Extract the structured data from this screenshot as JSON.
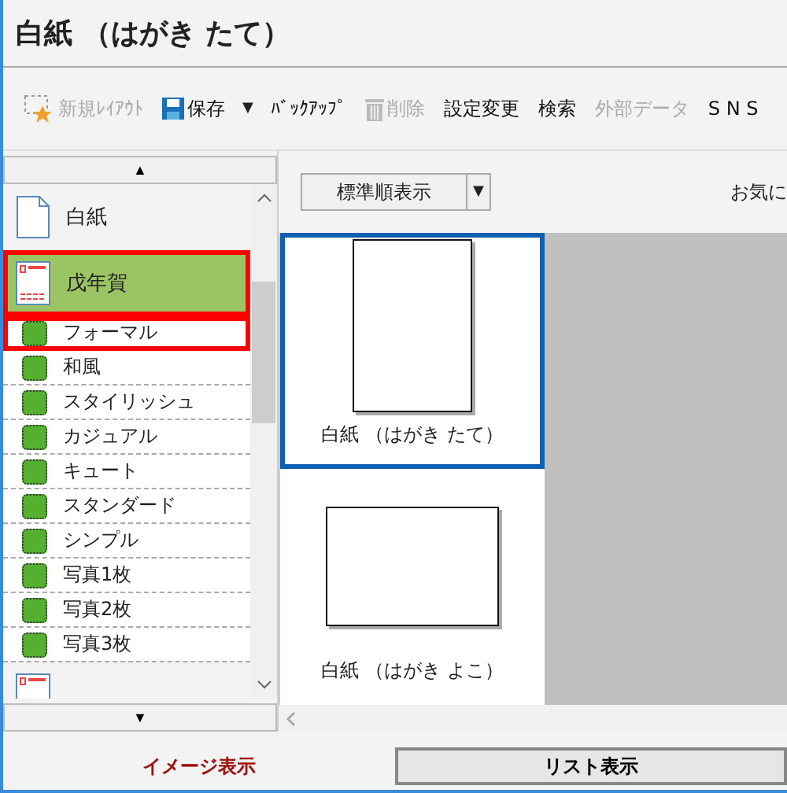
{
  "window": {
    "title": "白紙 （はがき たて）"
  },
  "toolbar": [
    {
      "label": "新規ﾚｲｱｳﾄ",
      "kind": "new",
      "disabled": true
    },
    {
      "label": "保存",
      "kind": "save",
      "disabled": false,
      "dropdown": "▼"
    },
    {
      "label": "ﾊﾞｯｸｱｯﾌﾟ",
      "disabled": false
    },
    {
      "label": "削除",
      "kind": "delete",
      "disabled": true
    },
    {
      "label": "設定変更",
      "disabled": false
    },
    {
      "label": "検索",
      "disabled": false
    },
    {
      "label": "外部データ",
      "disabled": true
    },
    {
      "label": "S N S",
      "disabled": false
    }
  ],
  "sidebar": {
    "scroll_up": "▲",
    "scroll_down": "▼",
    "categories": [
      {
        "label": "白紙",
        "kind": "blank",
        "selected": false,
        "highlighted": false
      },
      {
        "label": "戊年賀",
        "kind": "card",
        "selected": true,
        "highlighted": true,
        "children": [
          {
            "label": "フォーマル",
            "highlighted": true
          },
          {
            "label": "和風",
            "highlighted": false
          },
          {
            "label": "スタイリッシュ",
            "highlighted": false
          },
          {
            "label": "カジュアル",
            "highlighted": false
          },
          {
            "label": "キュート",
            "highlighted": false
          },
          {
            "label": "スタンダード",
            "highlighted": false
          },
          {
            "label": "シンプル",
            "highlighted": false
          },
          {
            "label": "写真1枚",
            "highlighted": false
          },
          {
            "label": "写真2枚",
            "highlighted": false
          },
          {
            "label": "写真3枚",
            "highlighted": false
          }
        ]
      },
      {
        "kind": "card",
        "selected": false,
        "highlighted": false
      }
    ]
  },
  "sort": {
    "value": "標準順表示",
    "caret": "▼"
  },
  "favorite_label": "お気に",
  "gallery": [
    {
      "label": "白紙 （はがき たて）",
      "kind": "portrait",
      "selected": true
    },
    {
      "label": "白紙 （はがき よこ）",
      "kind": "landscape",
      "selected": false
    }
  ],
  "view_tabs": [
    {
      "label": "イメージ表示",
      "selected": true
    },
    {
      "label": "リスト表示",
      "selected": false
    }
  ]
}
